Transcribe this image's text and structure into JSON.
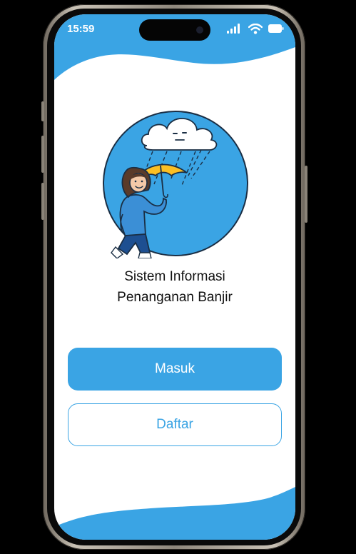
{
  "status_bar": {
    "time": "15:59",
    "icons": [
      "signal-icon",
      "wifi-icon",
      "battery-icon"
    ]
  },
  "illustration": {
    "icon": "flood-rain-umbrella-illustration",
    "colors": {
      "circle": "#3aa4e4",
      "umbrella": "#fbbf24"
    }
  },
  "app": {
    "title_line1": "Sistem Informasi",
    "title_line2": "Penanganan Banjir"
  },
  "actions": {
    "login_label": "Masuk",
    "register_label": "Daftar"
  },
  "colors": {
    "accent": "#3aa4e4",
    "background": "#ffffff"
  }
}
